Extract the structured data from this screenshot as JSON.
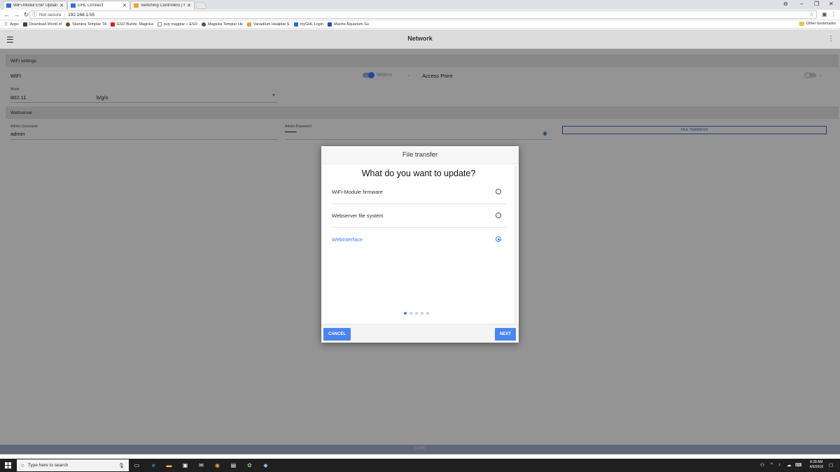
{
  "browser": {
    "tabs": [
      {
        "title": "WiFi-Modul ESP Updatv",
        "favicon_color": "#2f6fd6",
        "active": false
      },
      {
        "title": "GHL Connect",
        "favicon_color": "#2f6fd6",
        "active": true
      },
      {
        "title": "Switching Controllers | F",
        "favicon_color": "#e8a33c",
        "active": false
      }
    ],
    "security": "Not secure",
    "url": "192.168.1.55",
    "bookmarks": [
      {
        "label": "Apps",
        "color": "#3b6fc4"
      },
      {
        "label": "Download World of",
        "color": "#444444"
      },
      {
        "label": "Stamina Templar TA",
        "color": "#6b4a2a"
      },
      {
        "label": "ESO Builds: Magicka",
        "color": "#e02020"
      },
      {
        "label": "pvp magplar « ESO",
        "color": "#888888"
      },
      {
        "label": "Magicka Templar He",
        "color": "#555555"
      },
      {
        "label": "Vanadium Healplar S",
        "color": "#e8a33c"
      },
      {
        "label": "myGHL Login",
        "color": "#2f6fd6"
      },
      {
        "label": "Marine Aquarium Su",
        "color": "#2f4fb0"
      }
    ],
    "other_bookmarks": "Other bookmarks"
  },
  "app": {
    "title": "Network",
    "wifi_settings_header": "WiFi settings",
    "wifi_label": "WiFi",
    "mittens_label": "Mittens",
    "access_point_label": "Access Point",
    "mode_label": "Mode",
    "mode_value": "802.11",
    "mode_select": "b/g/n",
    "webserver_header": "Webserver",
    "admin_username_label": "Admin-Username",
    "admin_username_value": "admin",
    "admin_password_label": "Admin-Password",
    "admin_password_value": "••••••••",
    "file_transfer_button": "FILE TRANSFER",
    "save_button": "SAVE"
  },
  "dialog": {
    "title": "File transfer",
    "question": "What do you want to update?",
    "options": [
      {
        "label": "WiFi-Module firmware",
        "selected": false
      },
      {
        "label": "Webserver file system",
        "selected": false
      },
      {
        "label": "Webinterface",
        "selected": true
      }
    ],
    "step_total": 5,
    "step_current": 1,
    "cancel_label": "CANCEL",
    "next_label": "NEXT"
  },
  "taskbar": {
    "search_placeholder": "Type here to search",
    "time": "8:28 AM",
    "date": "4/6/2018"
  },
  "colors": {
    "accent": "#3b82f6",
    "button_blue": "#4b86f0",
    "save_bar": "#a6b6d1"
  }
}
